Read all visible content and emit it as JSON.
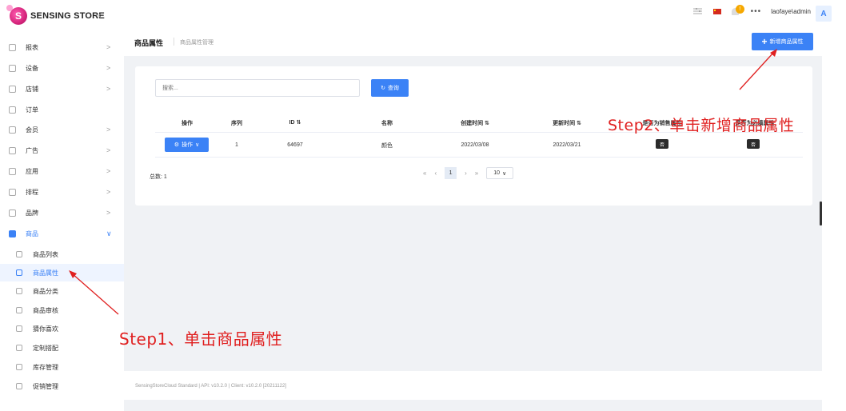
{
  "app": {
    "logo_letter": "S",
    "logo_text": "SENSING STORE",
    "collapse_icon": "«"
  },
  "topbar": {
    "badge_count": "!",
    "more": "•••",
    "user": "laofaye\\admin",
    "avatar_letter": "A"
  },
  "sidebar": {
    "items": [
      {
        "label": "报表",
        "arrow": ">"
      },
      {
        "label": "设备",
        "arrow": ">"
      },
      {
        "label": "店铺",
        "arrow": ">"
      },
      {
        "label": "订单",
        "arrow": ""
      },
      {
        "label": "会员",
        "arrow": ">"
      },
      {
        "label": "广告",
        "arrow": ">"
      },
      {
        "label": "应用",
        "arrow": ">"
      },
      {
        "label": "排程",
        "arrow": ">"
      },
      {
        "label": "品牌",
        "arrow": ">"
      },
      {
        "label": "商品",
        "arrow": "∨"
      }
    ],
    "sub_items": [
      {
        "label": "商品列表"
      },
      {
        "label": "商品属性"
      },
      {
        "label": "商品分类"
      },
      {
        "label": "商品审核"
      },
      {
        "label": "猜你喜欢"
      },
      {
        "label": "定制搭配"
      },
      {
        "label": "库存管理"
      },
      {
        "label": "促销管理"
      }
    ]
  },
  "page": {
    "title": "商品属性",
    "breadcrumb": "商品属性管理",
    "add_button": "新增商品属性",
    "add_icon": "+"
  },
  "search": {
    "placeholder": "搜索...",
    "button": "查询",
    "button_icon": "↻"
  },
  "table": {
    "headers": {
      "action": "操作",
      "seq": "序列",
      "id": "ID ⇅",
      "name": "名称",
      "created": "创建时间 ⇅",
      "updated": "更新时间 ⇅",
      "sale_attr": "是否为销售属性",
      "other_attr": "是否为必填属性"
    },
    "rows": [
      {
        "action_label": "操作",
        "action_icon": "⚙",
        "action_caret": "∨",
        "seq": "1",
        "id": "64697",
        "name": "颜色",
        "created": "2022/03/08",
        "updated": "2022/03/21",
        "sale_attr": "否",
        "other_attr": "否"
      }
    ]
  },
  "pagination": {
    "total": "总数: 1",
    "first": "«",
    "prev": "‹",
    "current": "1",
    "next": "›",
    "last": "»",
    "page_size": "10",
    "page_size_caret": "∨"
  },
  "footer": {
    "text": "SensingStoreCloud Standard | API: v10.2.0 | Client: v10.2.0 [20211122]"
  },
  "annotations": {
    "step1": "Step1、单击商品属性",
    "step2": "Step2、单击新增商品属性",
    "color": "#e02020"
  },
  "colors": {
    "primary": "#3b82f6",
    "background": "#f0f2f5",
    "badge": "#f6a800"
  }
}
